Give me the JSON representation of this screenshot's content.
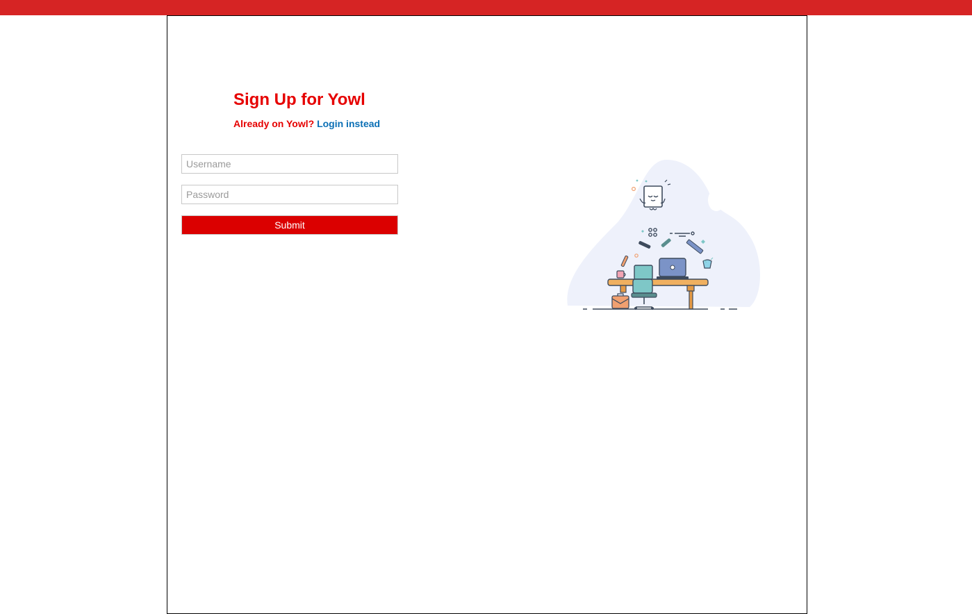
{
  "colors": {
    "topbar": "#d62424",
    "title": "#e60000",
    "link": "#0a6fb5",
    "submit_bg": "#db0000"
  },
  "header": {
    "title": "Sign Up for Yowl",
    "already_text": "Already on Yowl?",
    "login_link": "Login instead"
  },
  "form": {
    "username_placeholder": "Username",
    "password_placeholder": "Password",
    "submit_label": "Submit"
  },
  "illustration": {
    "icon": "workspace-desk-illustration"
  }
}
